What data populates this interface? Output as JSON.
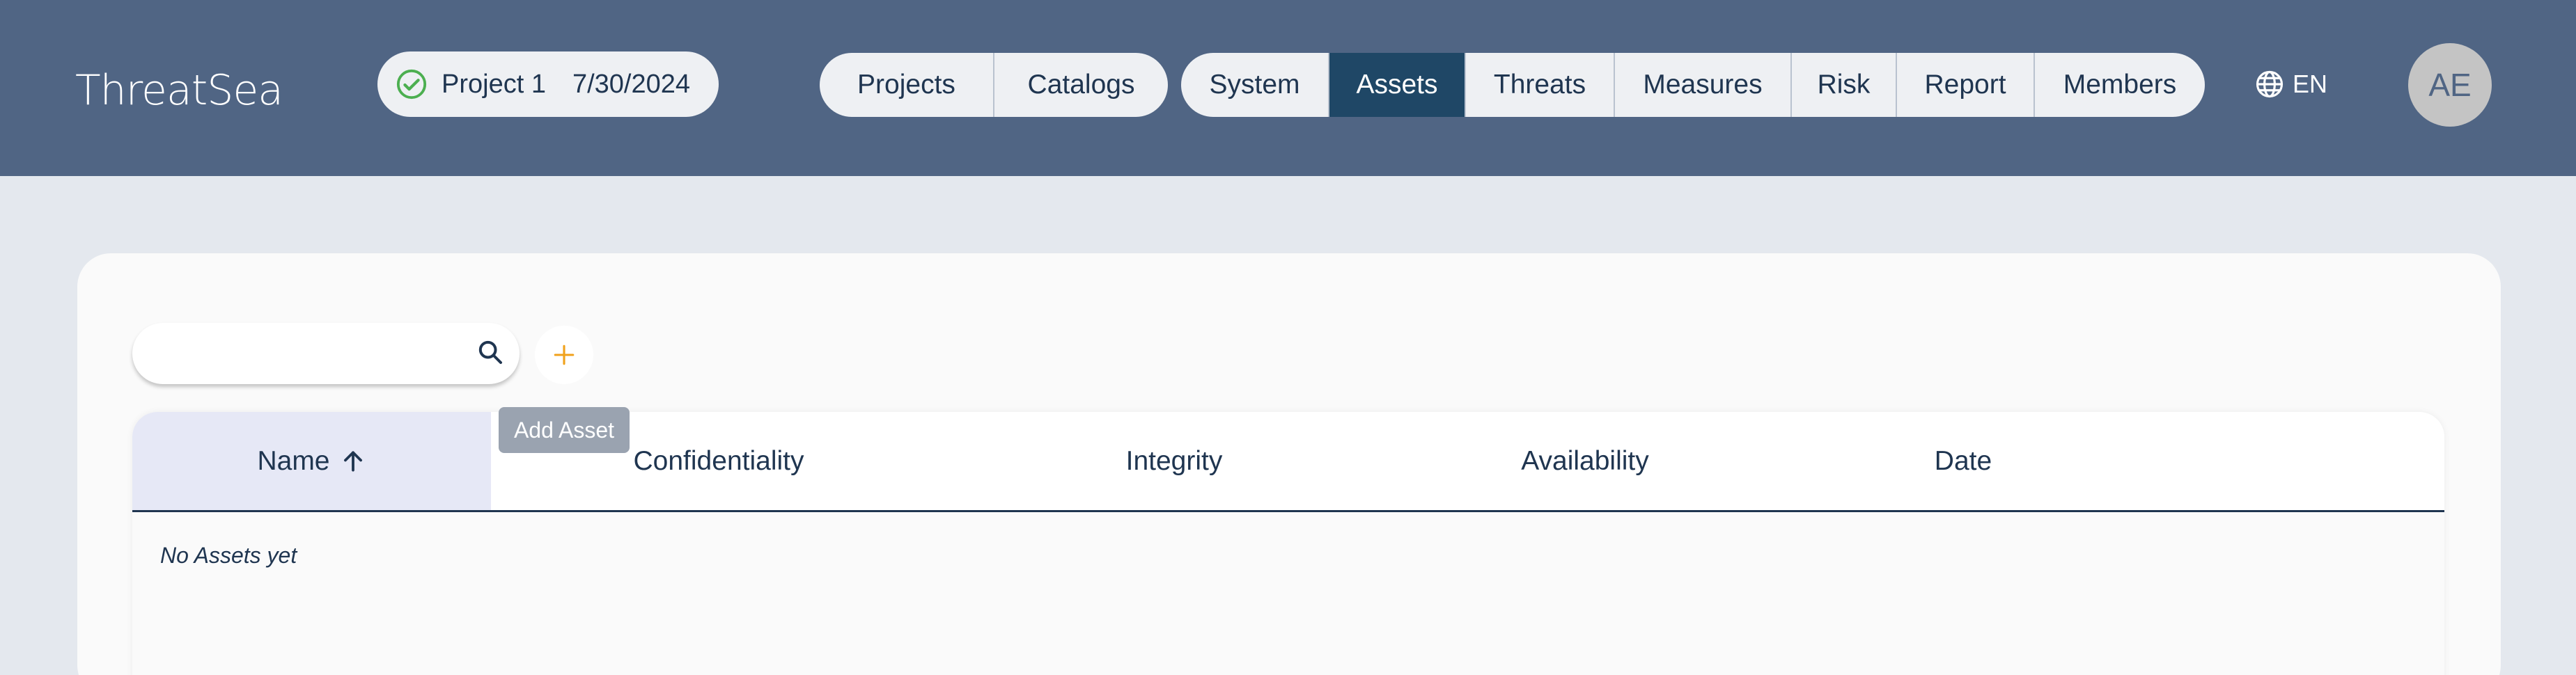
{
  "header": {
    "logo": "ThreatSea",
    "project": {
      "name": "Project 1",
      "date": "7/30/2024",
      "status_icon": "check-circle-icon"
    },
    "nav_left": [
      {
        "label": "Projects",
        "active": false
      },
      {
        "label": "Catalogs",
        "active": false
      }
    ],
    "nav_right": [
      {
        "label": "System",
        "active": false
      },
      {
        "label": "Assets",
        "active": true
      },
      {
        "label": "Threats",
        "active": false
      },
      {
        "label": "Measures",
        "active": false
      },
      {
        "label": "Risk",
        "active": false
      },
      {
        "label": "Report",
        "active": false
      },
      {
        "label": "Members",
        "active": false
      }
    ],
    "language": "EN",
    "avatar_initials": "AE"
  },
  "toolbar": {
    "search_value": "",
    "search_placeholder": "",
    "add_tooltip": "Add Asset"
  },
  "table": {
    "columns": [
      "Name",
      "Confidentiality",
      "Integrity",
      "Availability",
      "Date"
    ],
    "sorted_column": "Name",
    "sort_direction": "ascending",
    "empty_message": "No Assets yet"
  },
  "colors": {
    "header_bg": "#506584",
    "active_nav": "#1f4766",
    "accent_add": "#f0a21c",
    "status_ok": "#4caf50"
  }
}
